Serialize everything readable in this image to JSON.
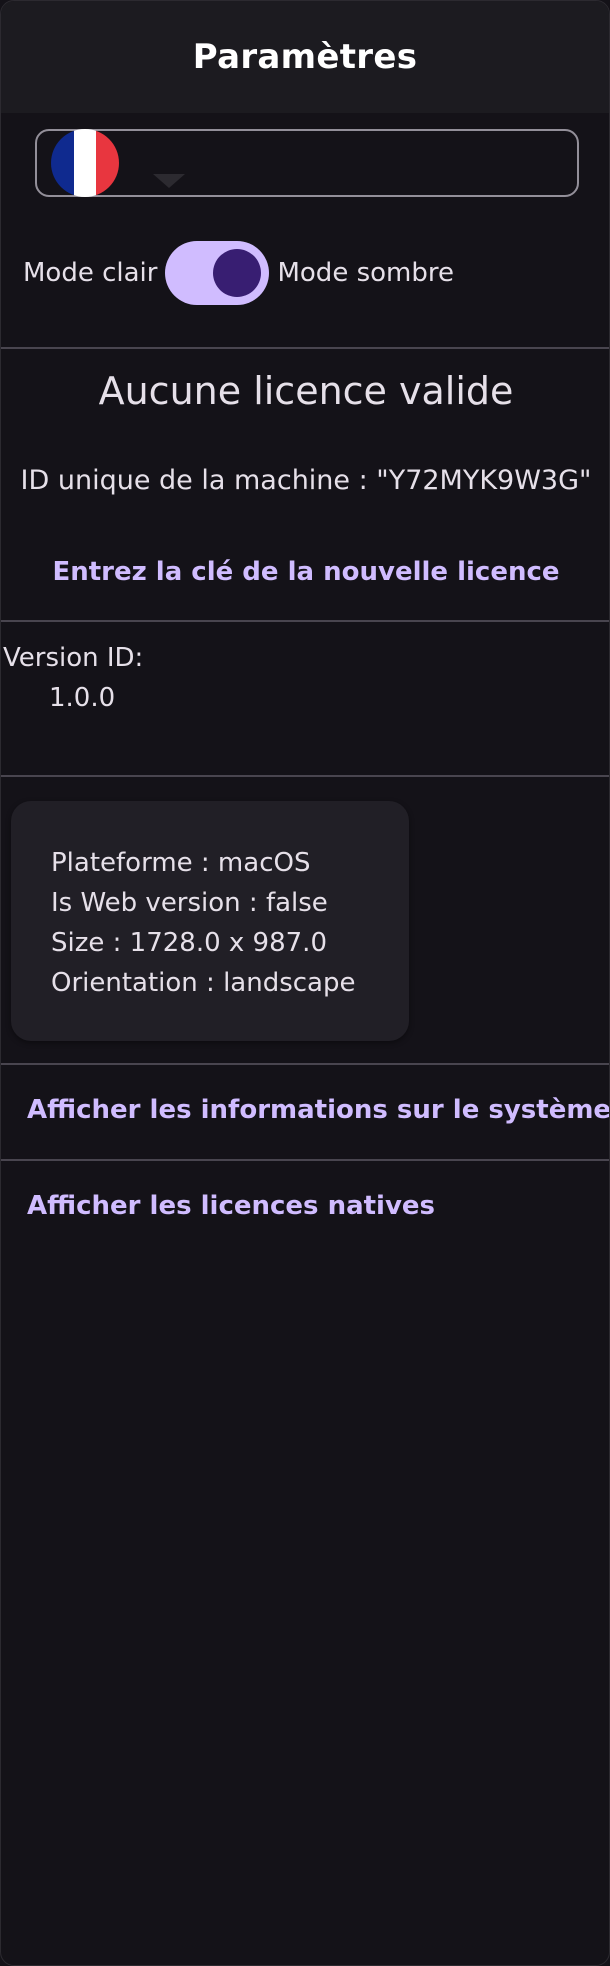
{
  "app_bar": {
    "title": "Paramètres"
  },
  "language_select": {
    "selected_flag": "flag-france",
    "colors": {
      "blue": "#0f2a8f",
      "white": "#ffffff",
      "red": "#e8363f"
    }
  },
  "theme": {
    "light_label": "Mode clair",
    "dark_label": "Mode sombre",
    "dark_mode_on": true,
    "accent": "#d0bcff"
  },
  "license": {
    "status_title": "Aucune licence valide",
    "machine_id_text": "ID unique de la machine : \"Y72MYK9W3G\"",
    "enter_key_link": "Entrez la clé de la nouvelle licence"
  },
  "version": {
    "label": "Version ID:",
    "value": "1.0.0"
  },
  "platform_info": {
    "lines": [
      "Plateforme : macOS",
      "Is Web version : false",
      "Size : 1728.0 x 987.0",
      "Orientation : landscape"
    ]
  },
  "links": {
    "system_info": "Afficher les informations sur le système",
    "native_licenses": "Afficher les licences natives"
  }
}
